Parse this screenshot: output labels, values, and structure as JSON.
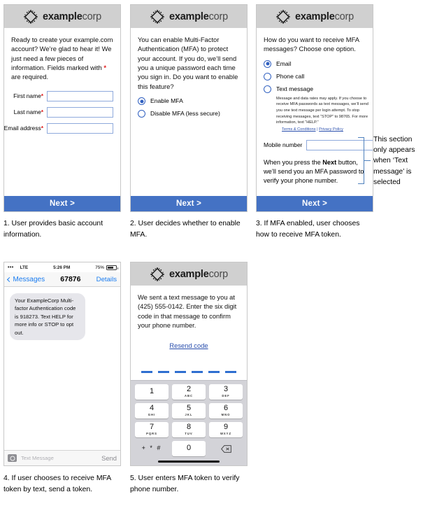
{
  "brand": {
    "bold": "example",
    "light": "corp",
    "logo_icon": "diamond-chip-logo"
  },
  "panel1": {
    "intro": "Ready to create your example.com account? We’re glad to hear it! We just need a few pieces of information. Fields marked with ",
    "intro_tail": " are required.",
    "required_marker": "*",
    "fields": [
      {
        "label": "First name",
        "required": "*",
        "value": "",
        "name": "first-name"
      },
      {
        "label": "Last name",
        "required": "*",
        "value": "",
        "name": "last-name"
      },
      {
        "label": "Email address",
        "required": "*",
        "value": "",
        "name": "email-address"
      }
    ],
    "next_label": "Next >"
  },
  "panel2": {
    "intro": "You can enable Multi-Factor Authentication (MFA) to protect your account. If you do, we’ll send you a unique password each time you sign in. Do you want to enable this feature?",
    "options": [
      {
        "label": "Enable MFA",
        "selected": true
      },
      {
        "label": "Disable MFA (less secure)",
        "selected": false
      }
    ],
    "next_label": "Next >"
  },
  "panel3": {
    "intro": "How do you want to receive MFA messages? Choose one option.",
    "options": [
      {
        "label": "Email",
        "selected": true
      },
      {
        "label": "Phone call",
        "selected": false
      },
      {
        "label": "Text message",
        "selected": false
      }
    ],
    "fineprint": "Message and data rates may apply. If you choose to receive MFA passwords as text messages, we’ll send you one text message per login attempt. To stop receiving messages, text “STOP” to 98765. For more information, text “HELP.”",
    "terms_label": "Terms & Conditions",
    "separator": "|",
    "privacy_label": "Privacy Policy",
    "mobile_label": "Mobile number",
    "mobile_value": "",
    "press_note_a": "When you press the ",
    "press_note_b": "Next",
    "press_note_c": " button, we’ll send you an MFA password to verify your phone number.",
    "next_label": "Next >"
  },
  "callout": {
    "text": "This section only appears when ‘Text message’ is selected"
  },
  "phone": {
    "status": {
      "dots": "•••",
      "carrier": "LTE",
      "time": "5:26 PM",
      "battery_pct": "75%",
      "battery_icon": "battery-icon"
    },
    "nav": {
      "back_label": "Messages",
      "back_icon": "chevron-left-icon",
      "title": "67876",
      "details_label": "Details"
    },
    "message": "Your ExampleCorp Multi-factor Authentication code is 918273. Text HELP for more info or STOP to opt out.",
    "compose": {
      "camera_icon": "camera-icon",
      "placeholder": "Text Message",
      "send_label": "Send"
    }
  },
  "panel5": {
    "intro": "We sent a text message to you at (425) 555-0142. Enter the six digit code in that message to confirm your phone number.",
    "resend_label": "Resend code",
    "code_slots": 6,
    "keypad": [
      [
        {
          "num": "1",
          "sub": ""
        },
        {
          "num": "2",
          "sub": "ABC"
        },
        {
          "num": "3",
          "sub": "DEF"
        }
      ],
      [
        {
          "num": "4",
          "sub": "GHI"
        },
        {
          "num": "5",
          "sub": "JKL"
        },
        {
          "num": "6",
          "sub": "MNO"
        }
      ],
      [
        {
          "num": "7",
          "sub": "PQRS"
        },
        {
          "num": "8",
          "sub": "TUV"
        },
        {
          "num": "9",
          "sub": "WXYZ"
        }
      ],
      [
        {
          "num": "+ * #",
          "sub": "",
          "blank": true
        },
        {
          "num": "0",
          "sub": ""
        },
        {
          "num": "",
          "sub": "",
          "blank": true,
          "icon": "backspace-icon"
        }
      ]
    ]
  },
  "captions": [
    "1. User provides basic account information.",
    "2. User decides whether to enable MFA.",
    "3. If MFA enabled, user chooses how to receive MFA token.",
    "4. If user chooses to receive MFA token by text, send a token.",
    "5. User enters MFA token to verify phone number."
  ],
  "colors": {
    "accent_blue": "#4472c4",
    "link_blue": "#2a4fad",
    "ios_blue": "#1a7cf0",
    "required_red": "#e01b1b",
    "header_gray": "#d0d0d0",
    "keypad_gray": "#d3d3d8"
  }
}
